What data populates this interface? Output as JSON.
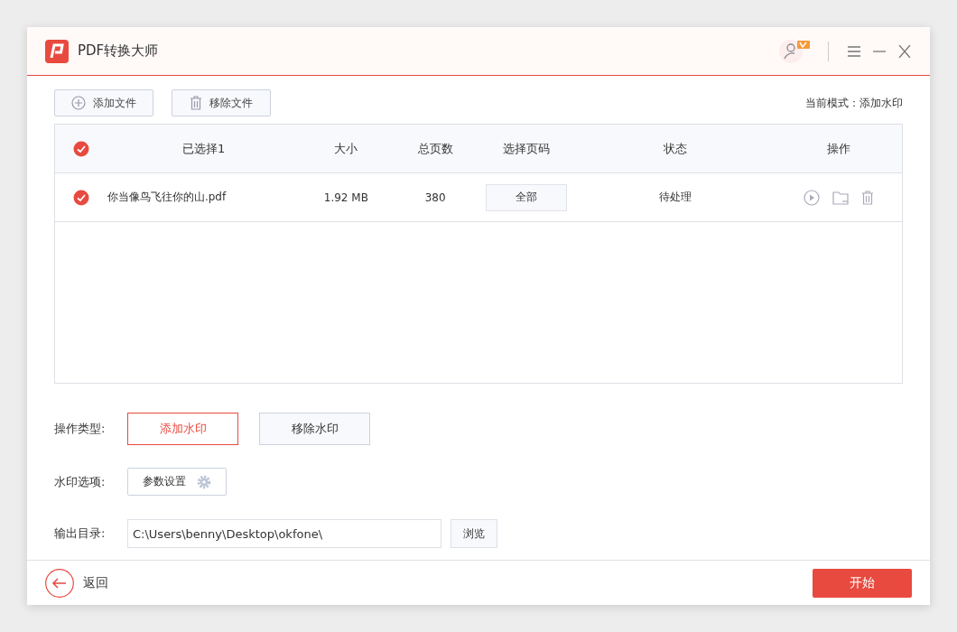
{
  "window": {
    "title": "PDF转换大师"
  },
  "toolbar": {
    "buttons": [
      {
        "kind": "add",
        "label": "添加文件"
      },
      {
        "kind": "remove",
        "label": "移除文件"
      }
    ],
    "mode": "当前模式：添加水印"
  },
  "table": {
    "select_all_checked": true,
    "columns": [
      "已选择1",
      "大小",
      "总页数",
      "选择页码",
      "状态",
      "操作"
    ],
    "rows": [
      {
        "checked": true,
        "name": "你当像鸟飞往你的山.pdf",
        "size": "1.92 MB",
        "pages": "380",
        "page_range": "全部",
        "status": "待处理"
      }
    ]
  },
  "options": {
    "operation_label": "操作类型:",
    "operations": [
      {
        "label": "添加水印",
        "selected": true
      },
      {
        "label": "移除水印",
        "selected": false
      }
    ],
    "watermark_label": "水印选项:",
    "settings_button": "参数设置",
    "output_label": "输出目录:",
    "output_path": "C:\\Users\\benny\\Desktop\\okfone\\",
    "browse_button": "浏览"
  },
  "footer": {
    "back": "返回",
    "start": "开始"
  }
}
